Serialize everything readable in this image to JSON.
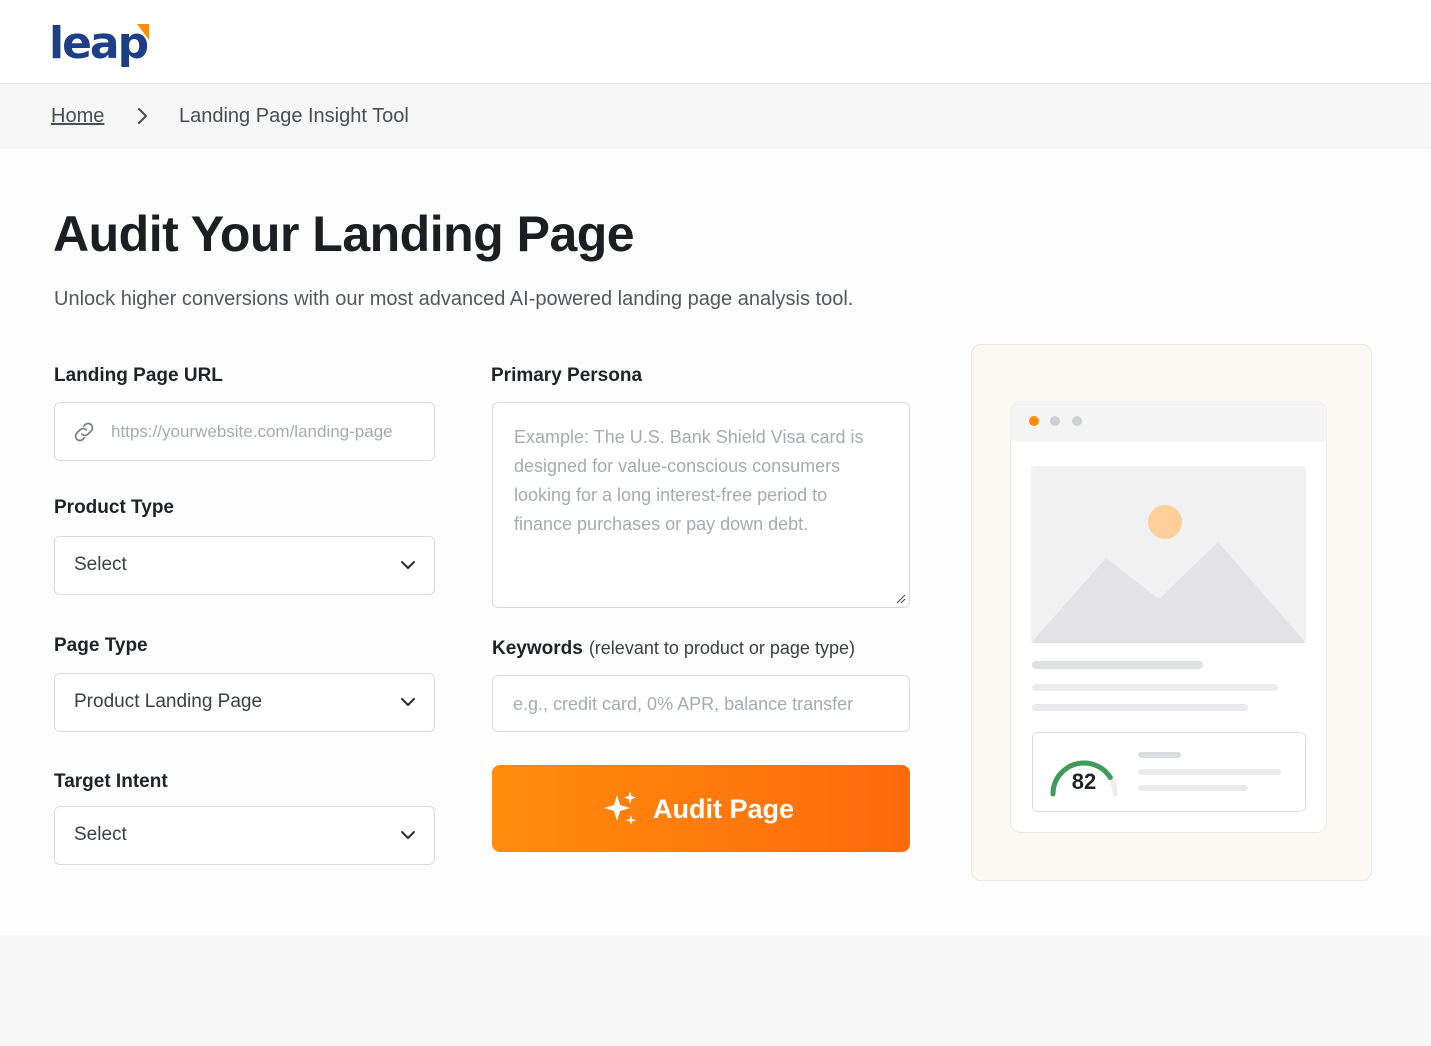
{
  "header": {
    "logo_text": "leap",
    "brand_color": "#1c3f86",
    "accent_color": "#ff8c0d"
  },
  "breadcrumb": {
    "home": "Home",
    "separator_icon": "chevron-right-icon",
    "current": "Landing Page Insight Tool"
  },
  "page": {
    "title": "Audit Your Landing Page",
    "subtitle": "Unlock higher conversions with our most advanced AI-powered landing page analysis tool."
  },
  "form": {
    "url": {
      "label": "Landing Page URL",
      "placeholder": "https://yourwebsite.com/landing-page",
      "icon": "link-icon"
    },
    "product_type": {
      "label": "Product Type",
      "value": "Select"
    },
    "page_type": {
      "label": "Page Type",
      "value": "Product Landing Page"
    },
    "target_intent": {
      "label": "Target Intent",
      "value": "Select"
    },
    "persona": {
      "label": "Primary Persona",
      "placeholder": "Example: The U.S. Bank Shield Visa card is designed for value-conscious consumers looking for a long interest-free period to finance purchases or pay down debt."
    },
    "keywords": {
      "label": "Keywords",
      "hint": "(relevant to product or page type)",
      "placeholder": "e.g., credit card, 0% APR, balance transfer"
    },
    "submit": {
      "label": "Audit Page",
      "icon": "sparkle-icon"
    }
  },
  "illustration": {
    "score": "82",
    "score_fraction": 0.82,
    "score_color": "#3f9a5b"
  }
}
